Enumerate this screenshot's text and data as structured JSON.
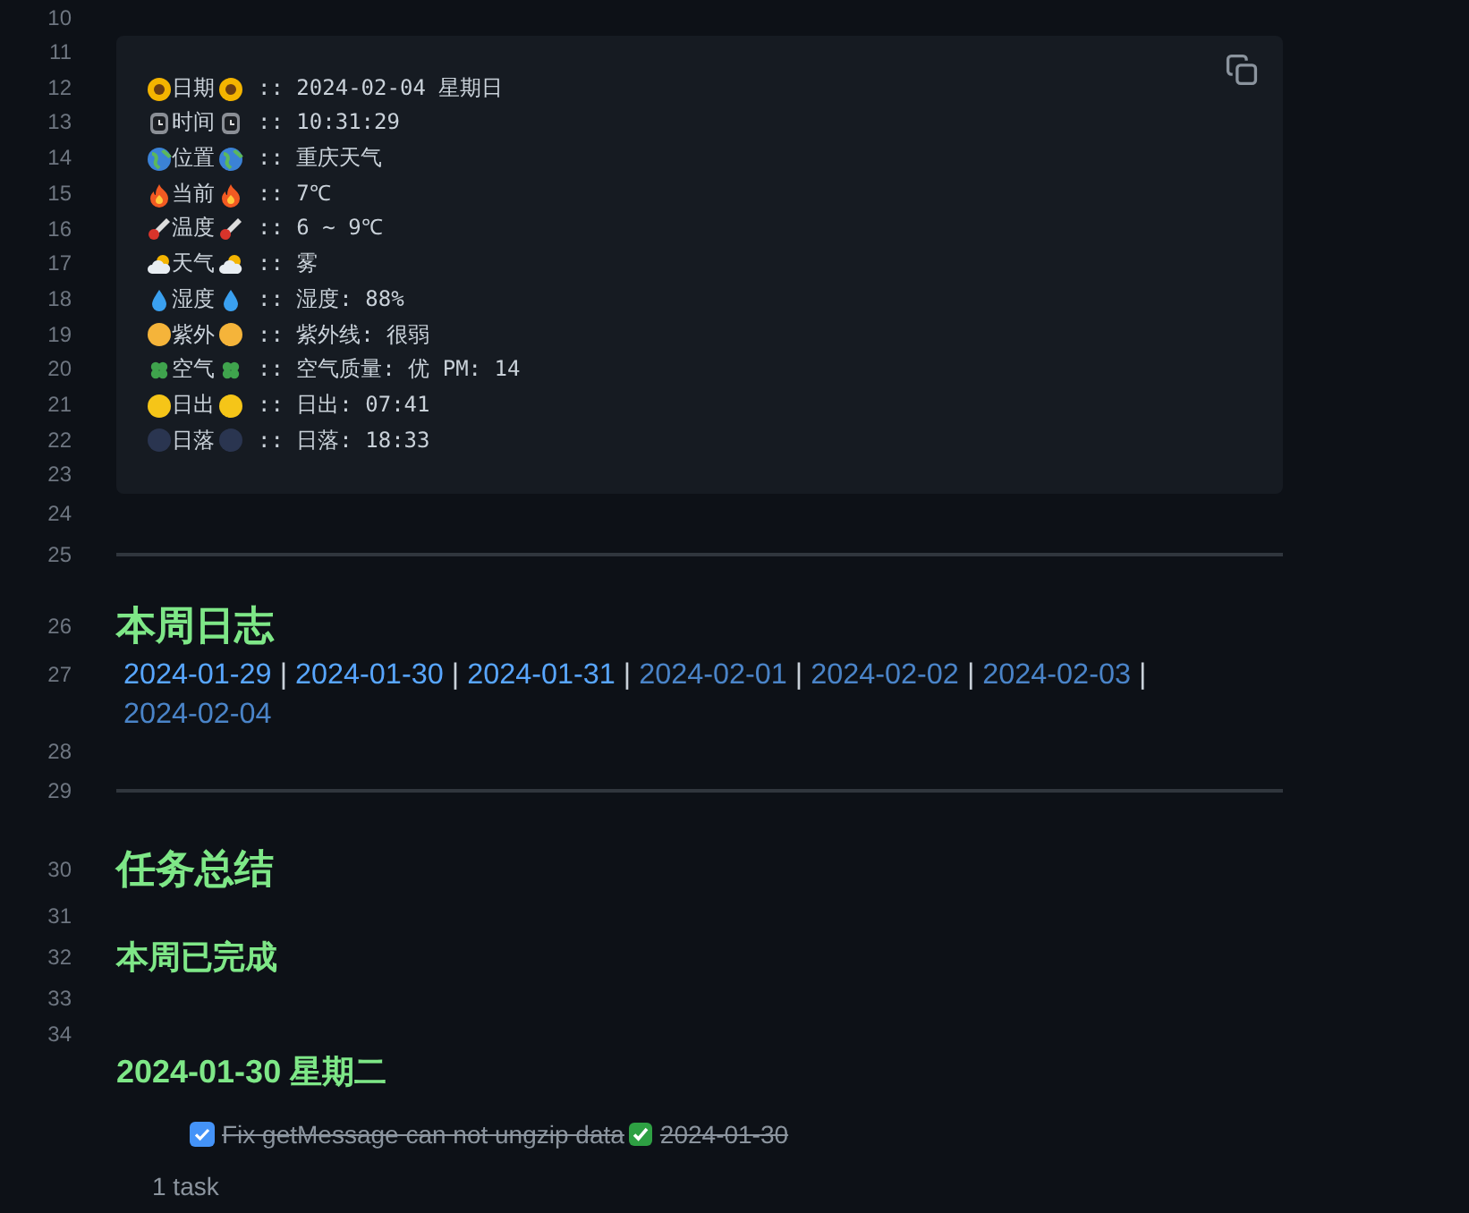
{
  "lines": [
    {
      "kind": "blank",
      "number": "10"
    },
    {
      "kind": "code",
      "numbers": [
        "11",
        "12",
        "13",
        "14",
        "15",
        "16",
        "17",
        "18",
        "19",
        "20",
        "21",
        "22",
        "23"
      ],
      "rows": [
        {
          "label": "日期",
          "value": ":: 2024-02-04 星期日"
        },
        {
          "label": "时间",
          "value": ":: 10:31:29"
        },
        {
          "label": "位置",
          "value": ":: 重庆天气"
        },
        {
          "label": "当前",
          "value": ":: 7℃"
        },
        {
          "label": "温度",
          "value": ":: 6 ~ 9℃"
        },
        {
          "label": "天气",
          "value": ":: 雾"
        },
        {
          "label": "湿度",
          "value": ":: 湿度: 88%"
        },
        {
          "label": "紫外",
          "value": ":: 紫外线: 很弱"
        },
        {
          "label": "空气",
          "value": ":: 空气质量: 优 PM: 14"
        },
        {
          "label": "日出",
          "value": ":: 日出: 07:41"
        },
        {
          "label": "日落",
          "value": ":: 日落: 18:33"
        }
      ]
    },
    {
      "kind": "blank",
      "number": "24"
    },
    {
      "kind": "rule",
      "number": "25"
    },
    {
      "kind": "heading",
      "number": "26",
      "text": "本周日志"
    },
    {
      "kind": "links",
      "number": "27",
      "separator": "|",
      "links": [
        {
          "text": "2024-01-29",
          "resolved": true
        },
        {
          "text": "2024-01-30",
          "resolved": true
        },
        {
          "text": "2024-01-31",
          "resolved": true
        },
        {
          "text": "2024-02-01",
          "resolved": false
        },
        {
          "text": "2024-02-02",
          "resolved": false
        },
        {
          "text": "2024-02-03",
          "resolved": false
        },
        {
          "text": "2024-02-04",
          "resolved": false
        }
      ]
    },
    {
      "kind": "blank",
      "number": "28"
    },
    {
      "kind": "rule",
      "number": "29"
    },
    {
      "kind": "heading",
      "number": "30",
      "text": "任务总结"
    },
    {
      "kind": "blank",
      "number": "31"
    },
    {
      "kind": "subheading",
      "number": "32",
      "text": "本周已完成"
    },
    {
      "kind": "blank",
      "number": "33"
    },
    {
      "kind": "blank",
      "number": "34"
    }
  ],
  "query_result": {
    "group": "2024-01-30 星期二",
    "tasks": [
      {
        "text": "Fix getMessage can not ungzip data",
        "date": "2024-01-30",
        "done": true
      }
    ],
    "count": "1 task"
  }
}
